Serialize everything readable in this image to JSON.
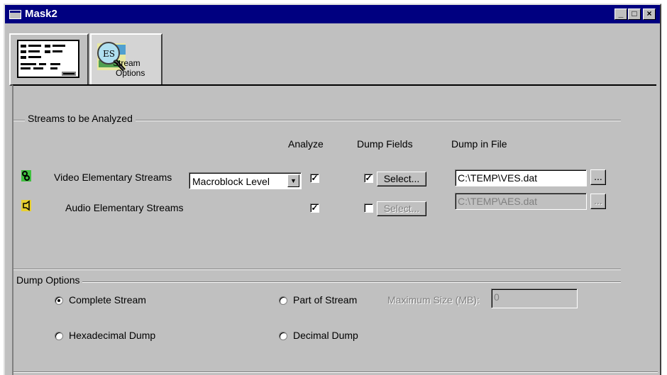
{
  "window": {
    "title": "Mask2",
    "controls": {
      "minimize": "_",
      "maximize": "□",
      "close": "×"
    }
  },
  "tabs": [
    {
      "label": "",
      "icon": "layout-icon"
    },
    {
      "label_line1": "Stream",
      "label_line2": "Options",
      "icon": "es-stream-icon"
    }
  ],
  "streams": {
    "group_label": "Streams to be Analyzed",
    "headers": {
      "analyze": "Analyze",
      "dump_fields": "Dump Fields",
      "dump_in_file": "Dump in File"
    },
    "video": {
      "label": "Video Elementary Streams",
      "level": "Macroblock Level",
      "analyze": "✓",
      "dump_fields": "✓",
      "select_label": "Select...",
      "file": "C:\\TEMP\\VES.dat",
      "browse_label": "..."
    },
    "audio": {
      "label": "Audio Elementary Streams",
      "analyze": "✓",
      "dump_fields": "",
      "select_label": "Select...",
      "file": "C:\\TEMP\\AES.dat",
      "browse_label": "..."
    }
  },
  "dump_options": {
    "group_label": "Dump Options",
    "complete_stream": "Complete Stream",
    "part_of_stream": "Part of Stream",
    "max_size_label": "Maximum Size (MB):",
    "max_size_value": "0",
    "hexadecimal_dump": "Hexadecimal Dump",
    "decimal_dump": "Decimal Dump"
  }
}
